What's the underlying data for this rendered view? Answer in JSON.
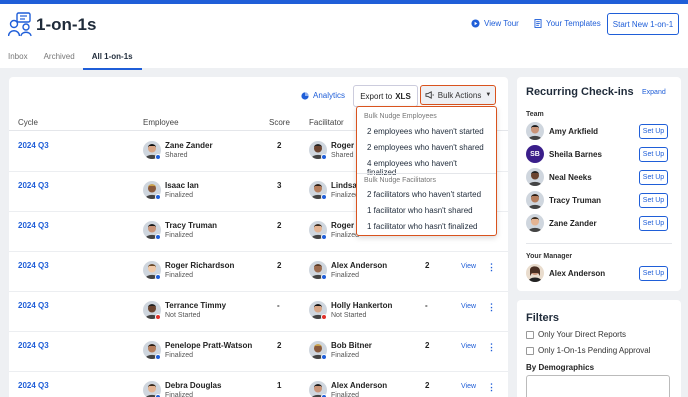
{
  "header": {
    "app_title": "1-on-1s",
    "view_tour": "View Tour",
    "templates": "Your Templates",
    "new_button": "Start New 1-on-1"
  },
  "tabs": [
    "Inbox",
    "Archived",
    "All 1-on-1s"
  ],
  "toolbar": {
    "analytics": "Analytics",
    "export_prefix": "Export to",
    "export_bold": "XLS",
    "bulk_actions": "Bulk Actions"
  },
  "table": {
    "headers": [
      "Cycle",
      "Employee",
      "Score",
      "Facilitator"
    ],
    "view_label": "View",
    "rows": [
      {
        "cycle": "2024 Q3",
        "employee": "Zane Zander",
        "emp_status": "Shared",
        "score": "2",
        "facilitator": "Roger",
        "fac_status": "Shared",
        "fscore": "",
        "show_actions": false
      },
      {
        "cycle": "2024 Q3",
        "employee": "Isaac Ian",
        "emp_status": "Finalized",
        "score": "3",
        "facilitator": "Lindsay",
        "fac_status": "Finalized",
        "fscore": "",
        "show_actions": false
      },
      {
        "cycle": "2024 Q3",
        "employee": "Tracy Truman",
        "emp_status": "Finalized",
        "score": "2",
        "facilitator": "Roger",
        "fac_status": "Finalized",
        "fscore": "",
        "show_actions": false
      },
      {
        "cycle": "2024 Q3",
        "employee": "Roger Richardson",
        "emp_status": "Finalized",
        "score": "2",
        "facilitator": "Alex Anderson",
        "fac_status": "Finalized",
        "fscore": "2",
        "show_actions": true
      },
      {
        "cycle": "2024 Q3",
        "employee": "Terrance Timmy",
        "emp_status": "Not Started",
        "score": "-",
        "facilitator": "Holly Hankerton",
        "fac_status": "Not Started",
        "fscore": "-",
        "show_actions": true
      },
      {
        "cycle": "2024 Q3",
        "employee": "Penelope Pratt-Watson",
        "emp_status": "Finalized",
        "score": "2",
        "facilitator": "Bob Bitner",
        "fac_status": "Finalized",
        "fscore": "2",
        "show_actions": true
      },
      {
        "cycle": "2024 Q3",
        "employee": "Debra Douglas",
        "emp_status": "Finalized",
        "score": "1",
        "facilitator": "Alex Anderson",
        "fac_status": "Finalized",
        "fscore": "2",
        "show_actions": true
      }
    ]
  },
  "dropdown": {
    "group1": "Bulk Nudge Employees",
    "items1": [
      "2 employees who haven't started",
      "2 employees who haven't shared",
      "4 employees who haven't finalized"
    ],
    "group2": "Bulk Nudge Facilitators",
    "items2": [
      "2 facilitators who haven't started",
      "1 facilitator who hasn't shared",
      "1 facilitator who hasn't finalized"
    ]
  },
  "recurring": {
    "title": "Recurring Check-ins",
    "expand": "Expand",
    "team_label": "Team",
    "setup_label": "Set Up",
    "team": [
      {
        "name": "Amy Arkfield",
        "initials": ""
      },
      {
        "name": "Sheila Barnes",
        "initials": "SB"
      },
      {
        "name": "Neal Neeks",
        "initials": ""
      },
      {
        "name": "Tracy Truman",
        "initials": ""
      },
      {
        "name": "Zane Zander",
        "initials": ""
      }
    ],
    "manager_label": "Your Manager",
    "manager": {
      "name": "Alex Anderson"
    }
  },
  "filters": {
    "title": "Filters",
    "options": [
      "Only Your Direct Reports",
      "Only 1-On-1s Pending Approval"
    ],
    "demographics": "By Demographics"
  },
  "colors": {
    "accent": "#1f5ed8",
    "highlight": "#d9531e",
    "status_blue": "#1f5ed8",
    "status_red": "#e0302a"
  }
}
